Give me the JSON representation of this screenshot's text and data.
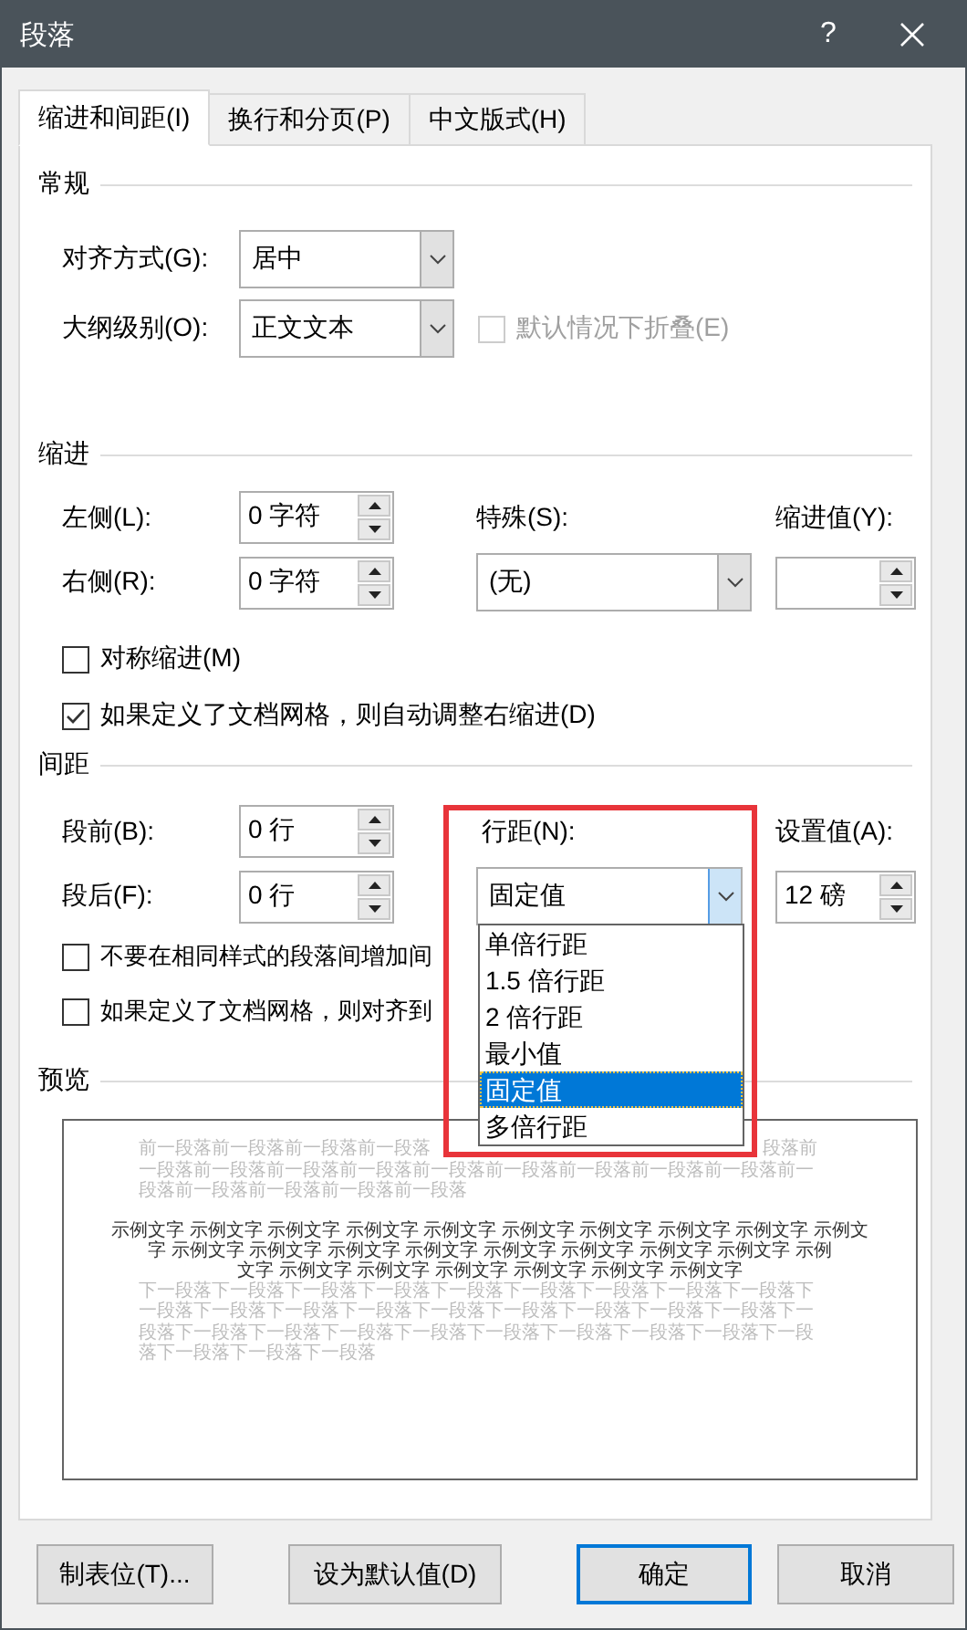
{
  "window": {
    "title": "段落",
    "help": "?"
  },
  "tabs": [
    {
      "label": "缩进和间距(I)",
      "selected": true
    },
    {
      "label": "换行和分页(P)",
      "selected": false
    },
    {
      "label": "中文版式(H)",
      "selected": false
    }
  ],
  "general": {
    "title": "常规",
    "alignment": {
      "label": "对齐方式(G):",
      "value": "居中"
    },
    "outline_level": {
      "label": "大纲级别(O):",
      "value": "正文文本"
    },
    "collapse": {
      "label": "默认情况下折叠(E)",
      "checked": false,
      "disabled": true
    }
  },
  "indentation": {
    "title": "缩进",
    "left": {
      "label": "左侧(L):",
      "value": "0 字符"
    },
    "right": {
      "label": "右侧(R):",
      "value": "0 字符"
    },
    "special": {
      "label": "特殊(S):",
      "value": "(无)"
    },
    "by": {
      "label": "缩进值(Y):"
    },
    "options": [
      {
        "label": "对称缩进(M)",
        "checked": false
      },
      {
        "label": "如果定义了文档网格，则自动调整右缩进(D)",
        "checked": true
      }
    ]
  },
  "spacing": {
    "title": "间距",
    "before": {
      "label": "段前(B):",
      "value": "0 行"
    },
    "after": {
      "label": "段后(F):",
      "value": "0 行"
    },
    "line_spacing": {
      "label": "行距(N):",
      "value": "固定值",
      "expanded": true,
      "highlighted": true,
      "options": [
        {
          "label": "单倍行距",
          "selected": false
        },
        {
          "label": "1.5 倍行距",
          "selected": false
        },
        {
          "label": "2 倍行距",
          "selected": false
        },
        {
          "label": "最小值",
          "selected": false
        },
        {
          "label": "固定值",
          "selected": true
        },
        {
          "label": "多倍行距",
          "selected": false
        }
      ]
    },
    "at": {
      "label": "设置值(A):",
      "value": "12 磅"
    },
    "options": [
      {
        "label": "不要在相同样式的段落间增加间",
        "checked": false
      },
      {
        "label": "如果定义了文档网格，则对齐到",
        "checked": false
      }
    ]
  },
  "preview": {
    "title": "预览",
    "previous": [
      [
        "前一段落前一段落前一段落前一段落",
        "段落前"
      ],
      [
        "一段落前一段落前一段落前一段落前一段落前一段落前一段落前一段落前一段落前一"
      ],
      [
        "段落前一段落前一段落前一段落前一段落"
      ]
    ],
    "sample": [
      "示例文字 示例文字 示例文字 示例文字 示例文字 示例文字 示例文字 示例文字 示例文字 示例文",
      "字 示例文字 示例文字 示例文字 示例文字 示例文字 示例文字 示例文字 示例文字 示例",
      "文字 示例文字 示例文字 示例文字 示例文字 示例文字 示例文字"
    ],
    "next": [
      "下一段落下一段落下一段落下一段落下一段落下一段落下一段落下一段落下一段落下",
      "一段落下一段落下一段落下一段落下一段落下一段落下一段落下一段落下一段落下一",
      "段落下一段落下一段落下一段落下一段落下一段落下一段落下一段落下一段落下一段",
      "落下一段落下一段落下一段落"
    ]
  },
  "buttons": [
    {
      "label": "制表位(T)...",
      "focused": false
    },
    {
      "label": "设为默认值(D)",
      "focused": false
    },
    {
      "label": "确定",
      "focused": true
    },
    {
      "label": "取消",
      "focused": false
    }
  ]
}
